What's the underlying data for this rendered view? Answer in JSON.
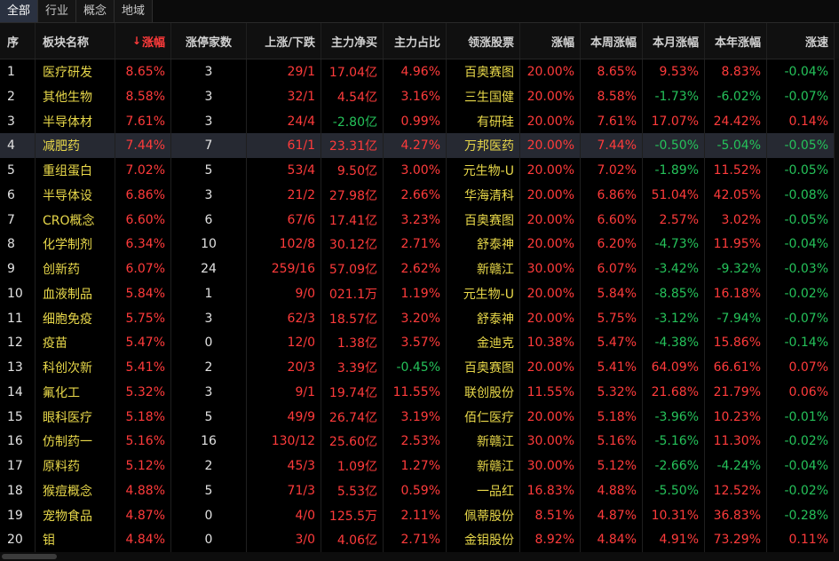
{
  "tabs": [
    {
      "label": "全部",
      "active": true
    },
    {
      "label": "行业",
      "active": false
    },
    {
      "label": "概念",
      "active": false
    },
    {
      "label": "地域",
      "active": false
    }
  ],
  "columns": [
    "序",
    "板块名称",
    "涨幅",
    "涨停家数",
    "上涨/下跌",
    "主力净买",
    "主力占比",
    "领涨股票",
    "涨幅",
    "本周涨幅",
    "本月涨幅",
    "本年涨幅",
    "涨速"
  ],
  "sorted_column_index": 2,
  "selected_row": 3,
  "colors": {
    "up": "#ff3b3b",
    "down": "#25c25a",
    "name": "#e8d84a",
    "selected": "#262932"
  },
  "rows": [
    [
      "1",
      "医疗研发",
      "8.65%",
      "3",
      "29/1",
      "17.04亿",
      "4.96%",
      "百奥赛图",
      "20.00%",
      "8.65%",
      "9.53%",
      "8.83%",
      "-0.04%"
    ],
    [
      "2",
      "其他生物",
      "8.58%",
      "3",
      "32/1",
      "4.54亿",
      "3.16%",
      "三生国健",
      "20.00%",
      "8.58%",
      "-1.73%",
      "-6.02%",
      "-0.07%"
    ],
    [
      "3",
      "半导体材",
      "7.61%",
      "3",
      "24/4",
      "-2.80亿",
      "0.99%",
      "有研硅",
      "20.00%",
      "7.61%",
      "17.07%",
      "24.42%",
      "0.14%"
    ],
    [
      "4",
      "减肥药",
      "7.44%",
      "7",
      "61/1",
      "23.31亿",
      "4.27%",
      "万邦医药",
      "20.00%",
      "7.44%",
      "-0.50%",
      "-5.04%",
      "-0.05%"
    ],
    [
      "5",
      "重组蛋白",
      "7.02%",
      "5",
      "53/4",
      "9.50亿",
      "3.00%",
      "元生物-U",
      "20.00%",
      "7.02%",
      "-1.89%",
      "11.52%",
      "-0.05%"
    ],
    [
      "6",
      "半导体设",
      "6.86%",
      "3",
      "21/2",
      "27.98亿",
      "2.66%",
      "华海清科",
      "20.00%",
      "6.86%",
      "51.04%",
      "42.05%",
      "-0.08%"
    ],
    [
      "7",
      "CRO概念",
      "6.60%",
      "6",
      "67/6",
      "17.41亿",
      "3.23%",
      "百奥赛图",
      "20.00%",
      "6.60%",
      "2.57%",
      "3.02%",
      "-0.05%"
    ],
    [
      "8",
      "化学制剂",
      "6.34%",
      "10",
      "102/8",
      "30.12亿",
      "2.71%",
      "舒泰神",
      "20.00%",
      "6.20%",
      "-4.73%",
      "11.95%",
      "-0.04%"
    ],
    [
      "9",
      "创新药",
      "6.07%",
      "24",
      "259/16",
      "57.09亿",
      "2.62%",
      "新赣江",
      "30.00%",
      "6.07%",
      "-3.42%",
      "-9.32%",
      "-0.03%"
    ],
    [
      "10",
      "血液制品",
      "5.84%",
      "1",
      "9/0",
      "021.1万",
      "1.19%",
      "元生物-U",
      "20.00%",
      "5.84%",
      "-8.85%",
      "16.18%",
      "-0.02%"
    ],
    [
      "11",
      "细胞免疫",
      "5.75%",
      "3",
      "62/3",
      "18.57亿",
      "3.20%",
      "舒泰神",
      "20.00%",
      "5.75%",
      "-3.12%",
      "-7.94%",
      "-0.07%"
    ],
    [
      "12",
      "疫苗",
      "5.47%",
      "0",
      "12/0",
      "1.38亿",
      "3.57%",
      "金迪克",
      "10.38%",
      "5.47%",
      "-4.38%",
      "15.86%",
      "-0.14%"
    ],
    [
      "13",
      "科创次新",
      "5.41%",
      "2",
      "20/3",
      "3.39亿",
      "-0.45%",
      "百奥赛图",
      "20.00%",
      "5.41%",
      "64.09%",
      "66.61%",
      "0.07%"
    ],
    [
      "14",
      "氟化工",
      "5.32%",
      "3",
      "9/1",
      "19.74亿",
      "11.55%",
      "联创股份",
      "11.55%",
      "5.32%",
      "21.68%",
      "21.79%",
      "0.06%"
    ],
    [
      "15",
      "眼科医疗",
      "5.18%",
      "5",
      "49/9",
      "26.74亿",
      "3.19%",
      "佰仁医疗",
      "20.00%",
      "5.18%",
      "-3.96%",
      "10.23%",
      "-0.01%"
    ],
    [
      "16",
      "仿制药一",
      "5.16%",
      "16",
      "130/12",
      "25.60亿",
      "2.53%",
      "新赣江",
      "30.00%",
      "5.16%",
      "-5.16%",
      "11.30%",
      "-0.02%"
    ],
    [
      "17",
      "原料药",
      "5.12%",
      "2",
      "45/3",
      "1.09亿",
      "1.27%",
      "新赣江",
      "30.00%",
      "5.12%",
      "-2.66%",
      "-4.24%",
      "-0.04%"
    ],
    [
      "18",
      "猴痘概念",
      "4.88%",
      "5",
      "71/3",
      "5.53亿",
      "0.59%",
      "一品红",
      "16.83%",
      "4.88%",
      "-5.50%",
      "12.52%",
      "-0.02%"
    ],
    [
      "19",
      "宠物食品",
      "4.87%",
      "0",
      "4/0",
      "125.5万",
      "2.11%",
      "佩蒂股份",
      "8.51%",
      "4.87%",
      "10.31%",
      "36.83%",
      "-0.28%"
    ],
    [
      "20",
      "钼",
      "4.84%",
      "0",
      "3/0",
      "4.06亿",
      "2.71%",
      "金钼股份",
      "8.92%",
      "4.84%",
      "4.91%",
      "73.29%",
      "0.11%"
    ]
  ]
}
